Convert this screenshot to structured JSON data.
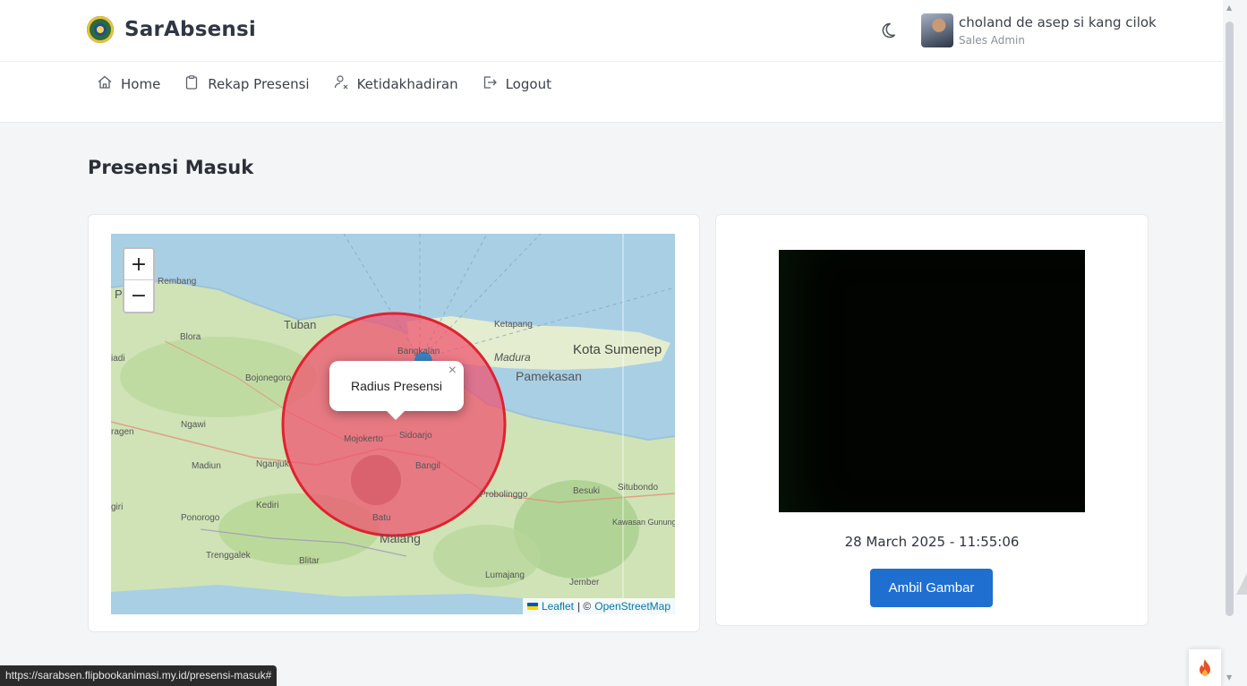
{
  "app": {
    "name": "SarAbsensi"
  },
  "user": {
    "name": "choland de asep si kang cilok",
    "role": "Sales Admin"
  },
  "nav": [
    {
      "label": "Home",
      "icon": "home-icon"
    },
    {
      "label": "Rekap Presensi",
      "icon": "clipboard-icon"
    },
    {
      "label": "Ketidakhadiran",
      "icon": "user-x-icon"
    },
    {
      "label": "Logout",
      "icon": "logout-icon"
    }
  ],
  "page": {
    "title": "Presensi Masuk"
  },
  "map": {
    "zoom_in": "+",
    "zoom_out": "−",
    "popup_text": "Radius Presensi",
    "popup_close": "×",
    "attribution_leaflet": "Leaflet",
    "attribution_sep": "| ©",
    "attribution_osm": "OpenStreetMap",
    "places": {
      "rembang": "Rembang",
      "tuban": "Tuban",
      "blora": "Blora",
      "bojonegoro": "Bojonegoro",
      "ngawi": "Ngawi",
      "madiun": "Madiun",
      "nganjuk": "Nganjuk",
      "ponorogo": "Ponorogo",
      "trenggalek": "Trenggalek",
      "blitar": "Blitar",
      "kediri": "Kediri",
      "batu": "Batu",
      "malang": "Malang",
      "lumajang": "Lumajang",
      "jember": "Jember",
      "probolinggo": "Probolinggo",
      "besuki": "Besuki",
      "situbondo": "Situbondo",
      "bangkalan": "Bangkalan",
      "madura": "Madura",
      "pamekasan": "Pamekasan",
      "kota_sumenep": "Kota Sumenep",
      "ketapang": "Ketapang",
      "mojokerto": "Mojokerto",
      "sidoarjo": "Sidoarjo",
      "bangil": "Bangil",
      "ragen": "ragen",
      "iadi": "iadi",
      "giri": "giri",
      "p": "P",
      "kawasan": "Kawasan Gunung Raung dan Gunung Ijen"
    }
  },
  "camera": {
    "timestamp": "28 March 2025 - 11:55:06",
    "capture_label": "Ambil Gambar"
  },
  "status_bar": {
    "url": "https://sarabsen.flipbookanimasi.my.id/presensi-masuk#"
  },
  "colors": {
    "primary": "#1e6fd0",
    "radius_fill": "#f0506e",
    "radius_stroke": "#e0222f"
  }
}
